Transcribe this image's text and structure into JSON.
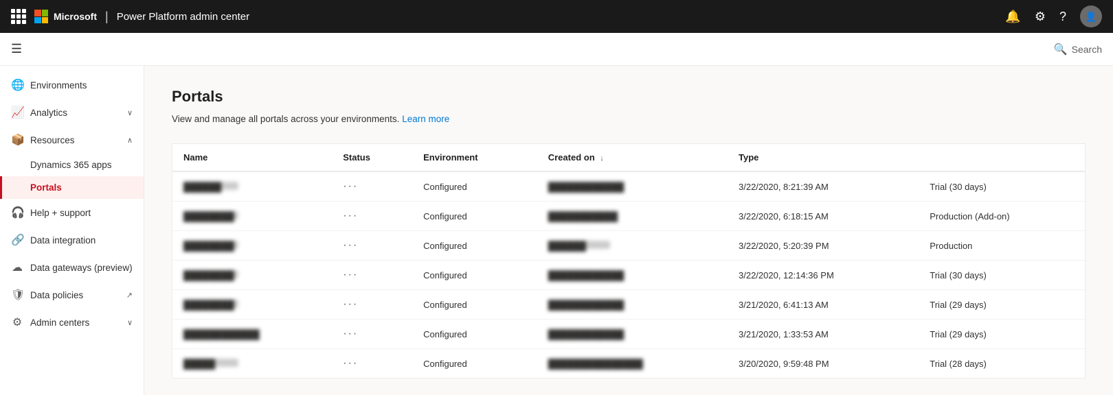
{
  "topbar": {
    "app_name": "Power Platform admin center",
    "ms_brand": "Microsoft",
    "icons": {
      "bell": "🔔",
      "settings": "⚙",
      "help": "?"
    }
  },
  "subbar": {
    "search_label": "Search",
    "search_icon": "🔍"
  },
  "sidebar": {
    "items": [
      {
        "id": "environments",
        "label": "Environments",
        "icon": "🌐",
        "expandable": false
      },
      {
        "id": "analytics",
        "label": "Analytics",
        "icon": "📈",
        "expandable": true,
        "expanded": false
      },
      {
        "id": "resources",
        "label": "Resources",
        "icon": "📦",
        "expandable": true,
        "expanded": true
      },
      {
        "id": "dynamics365",
        "label": "Dynamics 365 apps",
        "icon": "",
        "sub": true
      },
      {
        "id": "portals",
        "label": "Portals",
        "icon": "",
        "sub": true,
        "active": true
      },
      {
        "id": "help-support",
        "label": "Help + support",
        "icon": "🎧",
        "expandable": false
      },
      {
        "id": "data-integration",
        "label": "Data integration",
        "icon": "🔗",
        "expandable": false
      },
      {
        "id": "data-gateways",
        "label": "Data gateways (preview)",
        "icon": "☁",
        "expandable": false
      },
      {
        "id": "data-policies",
        "label": "Data policies",
        "icon": "🛡",
        "expandable": false,
        "ext": true
      },
      {
        "id": "admin-centers",
        "label": "Admin centers",
        "icon": "⚙",
        "expandable": true
      }
    ]
  },
  "main": {
    "title": "Portals",
    "subtitle": "View and manage all portals across your environments.",
    "learn_more": "Learn more",
    "table": {
      "columns": [
        {
          "id": "name",
          "label": "Name"
        },
        {
          "id": "status",
          "label": "Status"
        },
        {
          "id": "environment",
          "label": "Environment"
        },
        {
          "id": "created_on",
          "label": "Created on",
          "sort": "↓"
        },
        {
          "id": "type",
          "label": "Type"
        }
      ],
      "rows": [
        {
          "name": "██████",
          "status": "Configured",
          "environment": "████████████",
          "created_on": "3/22/2020, 8:21:39 AM",
          "type": "Trial (30 days)"
        },
        {
          "name": "████████",
          "status": "Configured",
          "environment": "███████████",
          "created_on": "3/22/2020, 6:18:15 AM",
          "type": "Production (Add-on)"
        },
        {
          "name": "████████",
          "status": "Configured",
          "environment": "██████",
          "created_on": "3/22/2020, 5:20:39 PM",
          "type": "Production"
        },
        {
          "name": "████████",
          "status": "Configured",
          "environment": "████████████",
          "created_on": "3/22/2020, 12:14:36 PM",
          "type": "Trial (30 days)"
        },
        {
          "name": "████████",
          "status": "Configured",
          "environment": "████████████",
          "created_on": "3/21/2020, 6:41:13 AM",
          "type": "Trial (29 days)"
        },
        {
          "name": "████████████",
          "status": "Configured",
          "environment": "████████████",
          "created_on": "3/21/2020, 1:33:53 AM",
          "type": "Trial (29 days)"
        },
        {
          "name": "█████",
          "status": "Configured",
          "environment": "███████████████",
          "created_on": "3/20/2020, 9:59:48 PM",
          "type": "Trial (28 days)"
        }
      ]
    }
  }
}
